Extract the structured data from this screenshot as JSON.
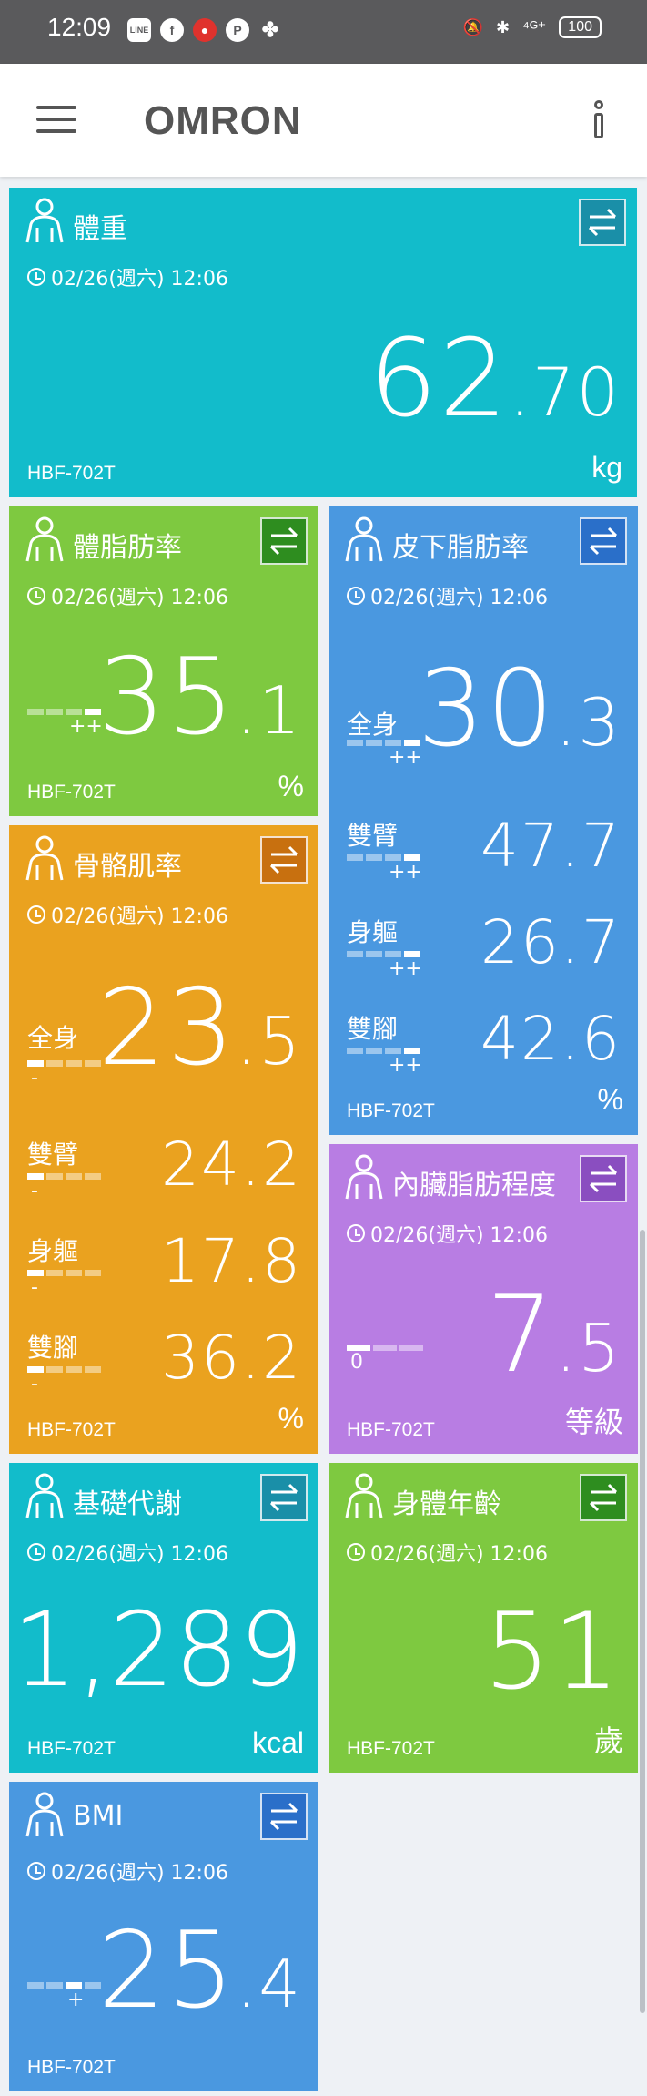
{
  "status_bar": {
    "time": "12:09",
    "notif_icons": [
      "LINE",
      "f",
      "●",
      "P",
      "✤"
    ],
    "right_icons": [
      "🔕",
      "✱",
      "⁴ᴳ⁺"
    ],
    "battery": "100"
  },
  "app_bar": {
    "logo": "OMRON"
  },
  "colors": {
    "teal": "#12bccb",
    "green": "#7ec940",
    "blue": "#4a98e0",
    "orange": "#eaa21f",
    "purple": "#b87de3",
    "swap_teal": "#1a8fa8",
    "swap_green": "#2e8d1f",
    "swap_blue": "#2a6fc9",
    "swap_orange": "#c8700f",
    "swap_purple": "#8a4ec0"
  },
  "cards": {
    "weight": {
      "title": "體重",
      "date": "02/26(週六) 12:06",
      "int": "62",
      "dot": ".",
      "dec": "70",
      "unit": "kg",
      "device": "HBF-702T"
    },
    "bodyfat": {
      "title": "體脂肪率",
      "date": "02/26(週六) 12:06",
      "int": "35",
      "dot": ".",
      "dec": "1",
      "unit": "%",
      "device": "HBF-702T",
      "scale_mark": "++"
    },
    "subcut": {
      "title": "皮下脂肪率",
      "date": "02/26(週六) 12:06",
      "main_label": "全身",
      "int": "30",
      "dot": ".",
      "dec": "3",
      "rows": [
        {
          "label": "雙臂",
          "value": "47.7"
        },
        {
          "label": "身軀",
          "value": "26.7"
        },
        {
          "label": "雙腳",
          "value": "42.6"
        }
      ],
      "scale_mark": "++",
      "unit": "%",
      "device": "HBF-702T"
    },
    "skeletal": {
      "title": "骨骼肌率",
      "date": "02/26(週六) 12:06",
      "main_label": "全身",
      "int": "23",
      "dot": ".",
      "dec": "5",
      "rows": [
        {
          "label": "雙臂",
          "value": "24.2"
        },
        {
          "label": "身軀",
          "value": "17.8"
        },
        {
          "label": "雙腳",
          "value": "36.2"
        }
      ],
      "scale_mark": "-",
      "unit": "%",
      "device": "HBF-702T"
    },
    "visceral": {
      "title": "內臟脂肪程度",
      "date": "02/26(週六) 12:06",
      "int": "7",
      "dot": ".",
      "dec": "5",
      "scale_mark": "0",
      "unit": "等級",
      "device": "HBF-702T"
    },
    "bmr": {
      "title": "基礎代謝",
      "date": "02/26(週六) 12:06",
      "value": "1,289",
      "unit": "kcal",
      "device": "HBF-702T"
    },
    "age": {
      "title": "身體年齡",
      "date": "02/26(週六) 12:06",
      "value": "51",
      "unit": "歲",
      "device": "HBF-702T"
    },
    "bmi": {
      "title": "BMI",
      "date": "02/26(週六) 12:06",
      "int": "25",
      "dot": ".",
      "dec": "4",
      "scale_mark": "+",
      "device": "HBF-702T",
      "person_badge": "BMI"
    }
  }
}
